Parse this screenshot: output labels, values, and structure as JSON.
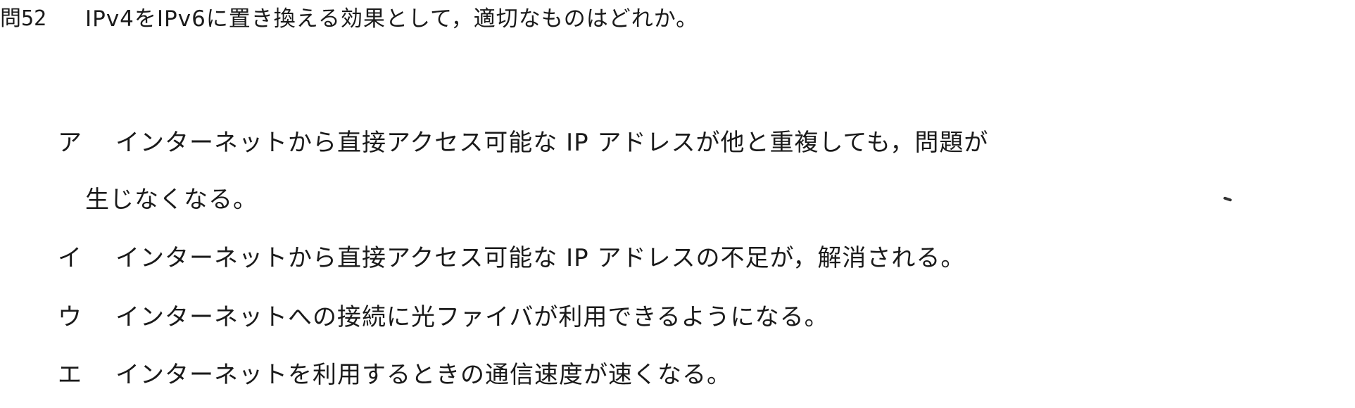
{
  "question": {
    "number": "問52",
    "text": "IPv4をIPv6に置き換える効果として，適切なものはどれか。"
  },
  "options": [
    {
      "marker": "ア",
      "text": "インターネットから直接アクセス可能な IP アドレスが他と重複しても，問題が",
      "continuation": "生じなくなる。"
    },
    {
      "marker": "イ",
      "text": "インターネットから直接アクセス可能な IP アドレスの不足が，解消される。"
    },
    {
      "marker": "ウ",
      "text": "インターネットへの接続に光ファイバが利用できるようになる。"
    },
    {
      "marker": "エ",
      "text": "インターネットを利用するときの通信速度が速くなる。"
    }
  ]
}
